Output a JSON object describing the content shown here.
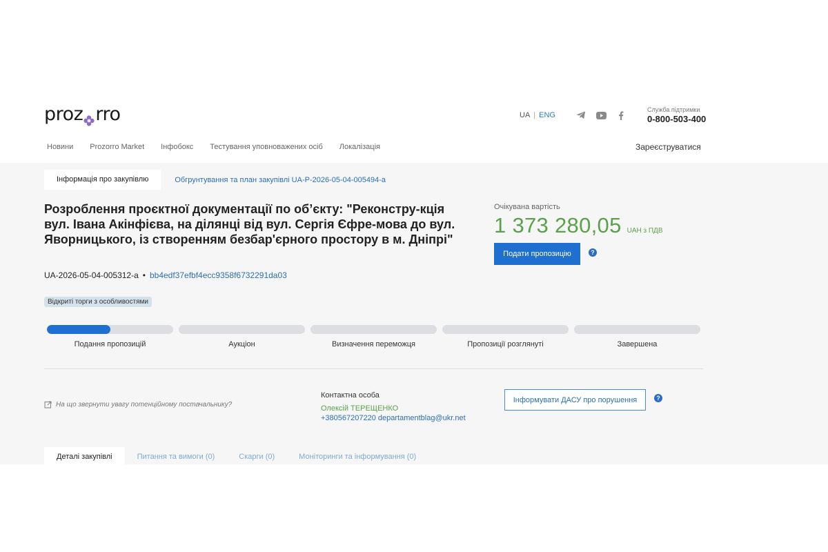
{
  "header": {
    "logo_before": "proz",
    "logo_after": "rro",
    "lang": {
      "ua": "UA",
      "eng": "ENG"
    },
    "support": {
      "label": "Служба підтримки",
      "phone": "0-800-503-400"
    },
    "nav": [
      "Новини",
      "Prozorro Market",
      "Інфобокс",
      "Тестування уповноважених осіб",
      "Локалізація"
    ],
    "register": "Зареєструватися",
    "social_icons": [
      "telegram-icon",
      "youtube-icon",
      "facebook-icon"
    ]
  },
  "subtabs": {
    "active": "Інформація про закупівлю",
    "link": "Обгрунтування та план закупівлі UA-P-2026-05-04-005494-a"
  },
  "tender": {
    "title": "Розроблення проєктної документації по об’єкту: \"Реконстру-кція вул. Івана Акінфієва, на ділянці від вул. Сергія Єфре-мова до вул. Яворницького, із створенням безбар'єрного простору в м. Дніпрі\"",
    "id": "UA-2026-05-04-005312-a",
    "separator": "•",
    "hash": "bb4edf37efbf4ecc9358f6732291da03",
    "badge": "Відкриті торги з особливостями"
  },
  "expected": {
    "label": "Очікувана вартість",
    "amount": "1 373 280,05",
    "vat": "UAH з ПДВ",
    "submit_button": "Подати пропозицію"
  },
  "stages": [
    {
      "label": "Подання пропозицій",
      "progress": 0.5
    },
    {
      "label": "Аукціон",
      "progress": 0
    },
    {
      "label": "Визначення переможця",
      "progress": 0
    },
    {
      "label": "Пропозиції розглянуті",
      "progress": 0
    },
    {
      "label": "Завершена",
      "progress": 0
    }
  ],
  "tip": "На що звернути увагу потенційному постачальнику?",
  "contact": {
    "label": "Контактна особа",
    "name": "Олексій ТЕРЕЩЕНКО",
    "info": "+380567207220 departamentblag@ukr.net"
  },
  "report_button": "Інформувати ДАСУ про порушення",
  "help_glyph": "?",
  "bottom_tabs": {
    "active": "Деталі закупівлі",
    "others": [
      "Питання та вимоги (0)",
      "Скарги (0)",
      "Моніторинги та інформування (0)"
    ]
  },
  "colors": {
    "primary": "#1f6fd0",
    "link": "#2a6fb8",
    "money": "#5aa24a",
    "badge": "#d3e1ea"
  }
}
